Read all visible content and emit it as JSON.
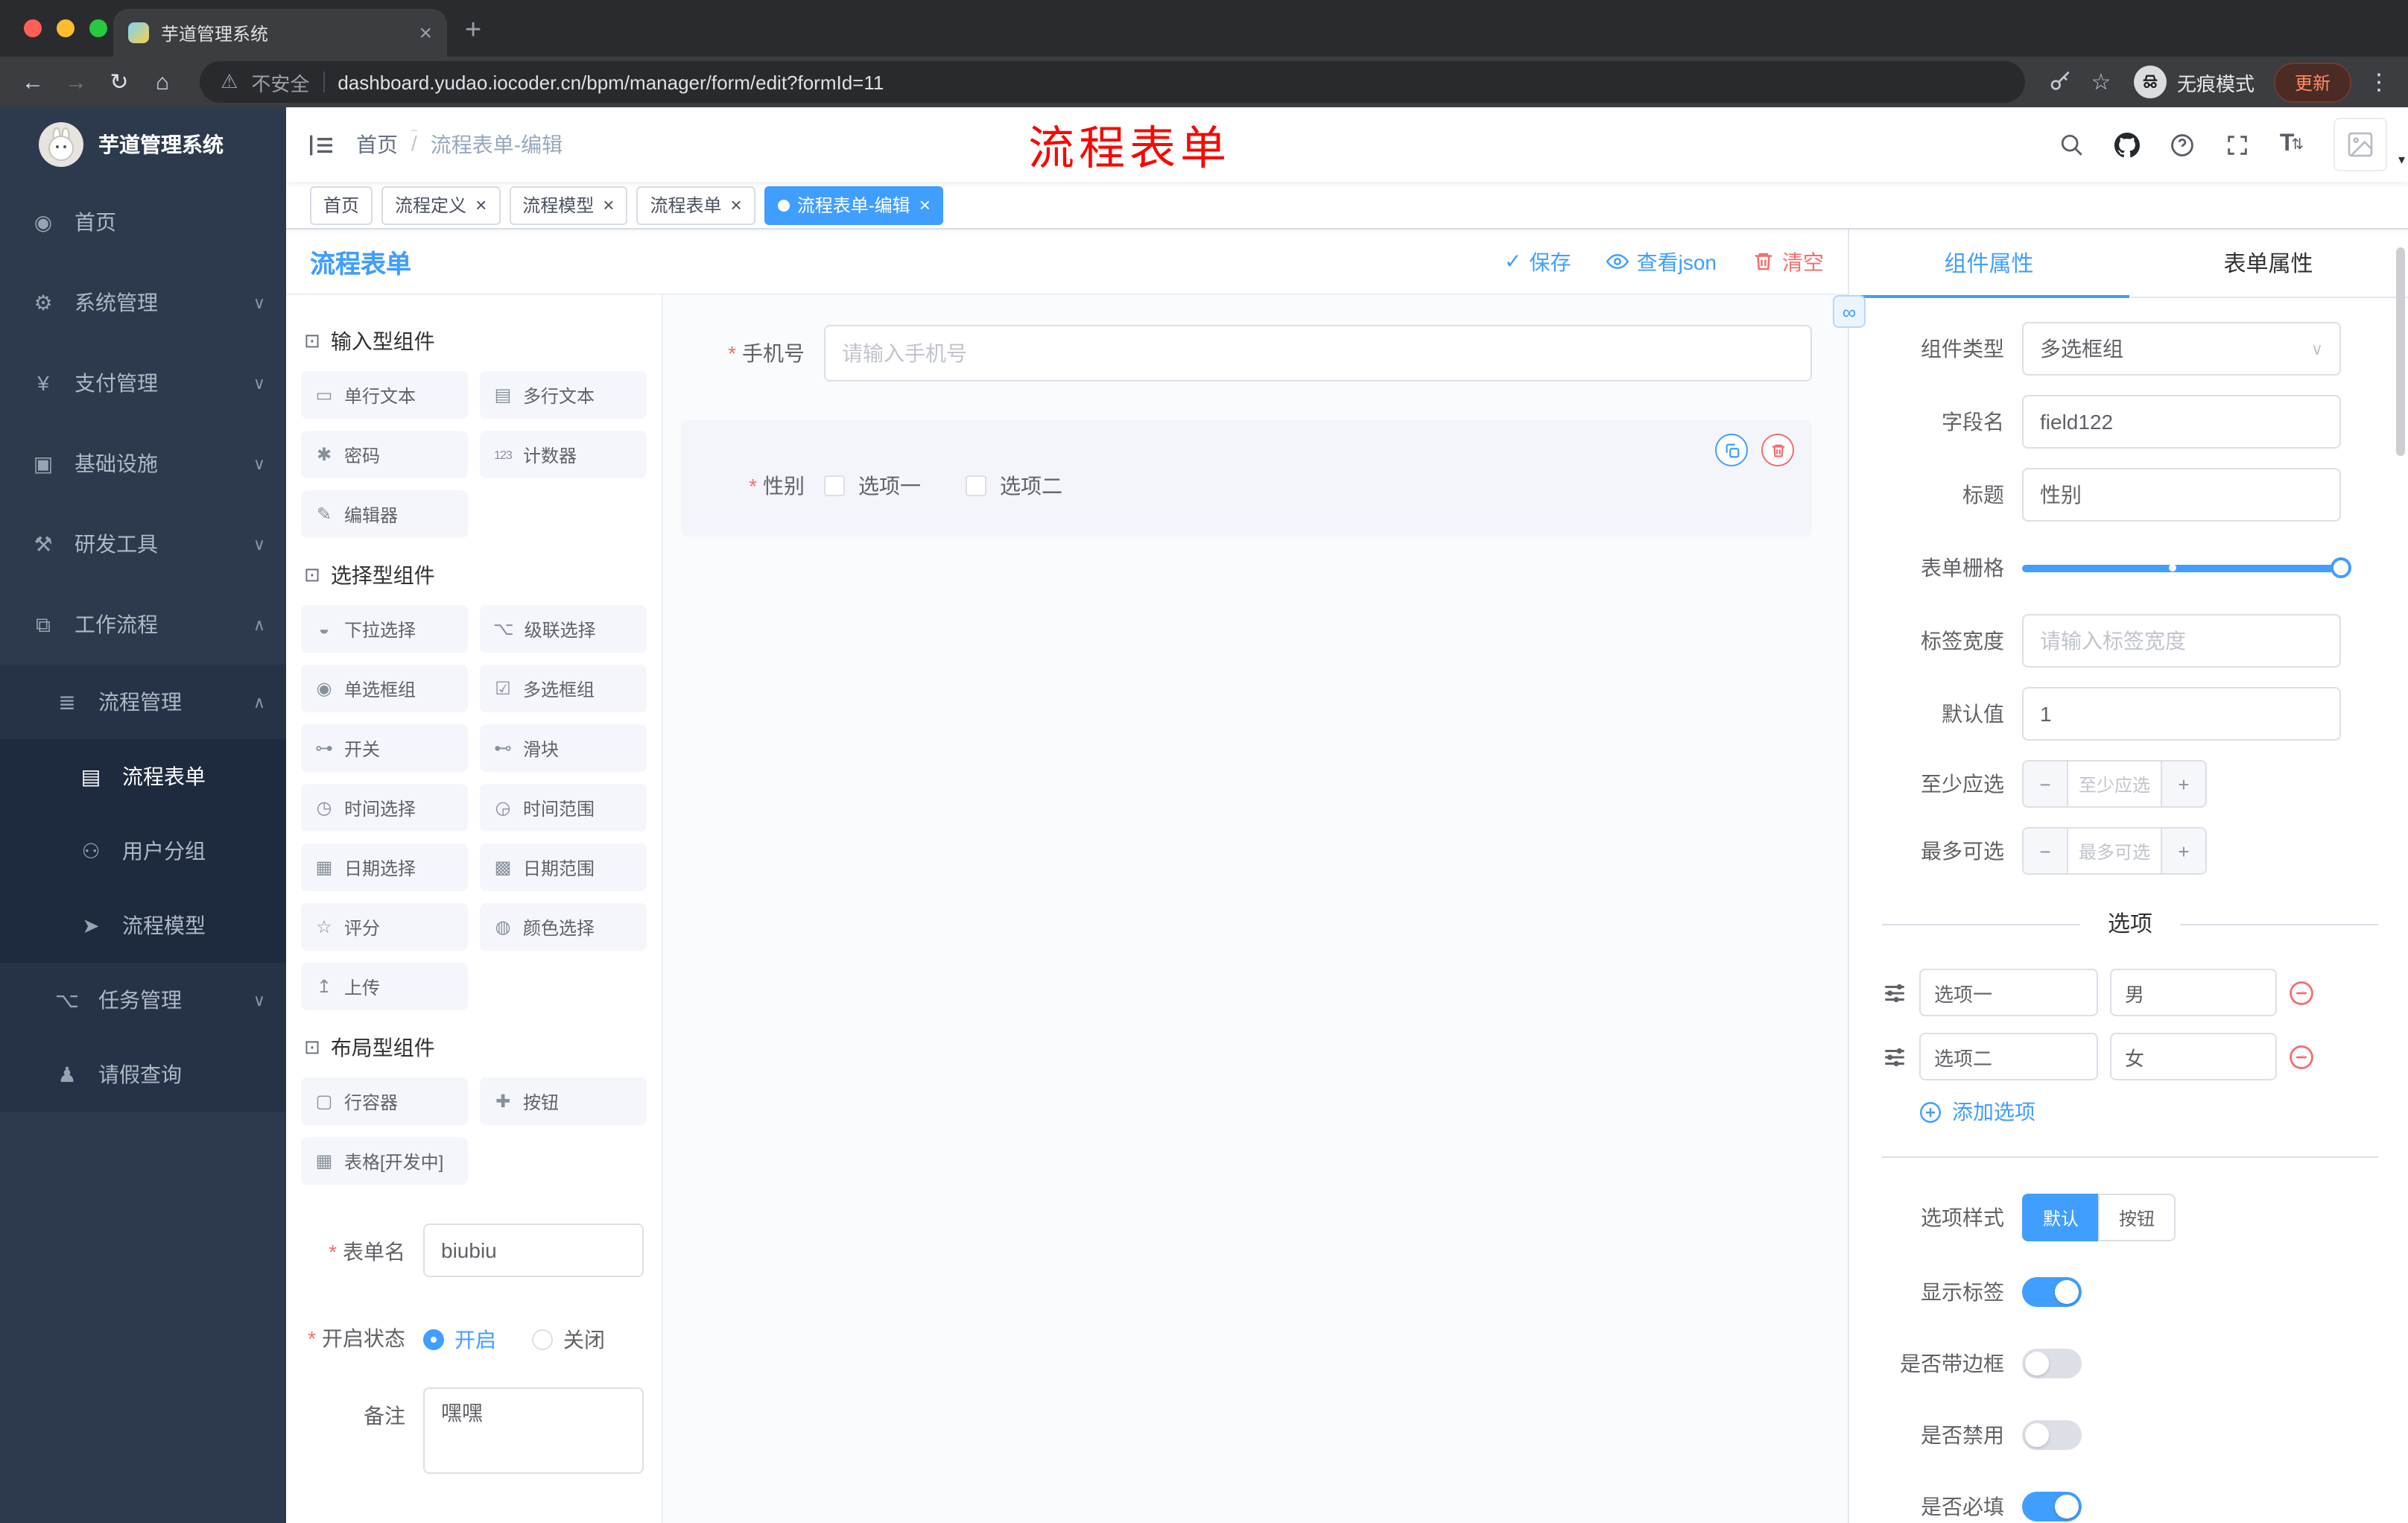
{
  "chrome": {
    "tab_title": "芋道管理系统",
    "security": "不安全",
    "url": "dashboard.yudao.iocoder.cn/bpm/manager/form/edit?formId=11",
    "incognito": "无痕模式",
    "update": "更新"
  },
  "icons": {
    "back": "←",
    "forward": "→",
    "reload": "↻",
    "home": "⌂",
    "warning": "⚠",
    "star": "☆",
    "more": "⋮",
    "close": "×",
    "new_tab": "+",
    "check": "✓",
    "link": "∞",
    "select_arrow": "∨",
    "minus": "−",
    "plus": "+",
    "caret": "▾",
    "font_size": "T",
    "updown": "⇅",
    "group": "⊡",
    "sidebar": {
      "dashboard": "◉",
      "gear": "⚙",
      "yen": "¥",
      "monitor": "▣",
      "tools": "⚒",
      "workflow": "⧉",
      "process": "≣",
      "form": "▤",
      "users": "⚇",
      "send": "➤",
      "tasks": "⌥",
      "person": "♟"
    },
    "components": {
      "single-line": "▭",
      "multi-line": "▤",
      "password": "✱",
      "counter": "123",
      "editor": "✎",
      "select": "◒",
      "cascader": "⌥",
      "radio": "◉",
      "checkbox": "☑",
      "switch": "⊶",
      "slider": "⊷",
      "time": "◷",
      "time-range": "◶",
      "date": "▦",
      "date-range": "▩",
      "rate": "☆",
      "color": "◍",
      "upload": "↥",
      "row": "▢",
      "button": "✚",
      "table": "▦"
    }
  },
  "sidebar": {
    "app_title": "芋道管理系统",
    "menu": [
      {
        "label": "首页",
        "icon": "dashboard"
      },
      {
        "label": "系统管理",
        "icon": "gear",
        "chevron": "down"
      },
      {
        "label": "支付管理",
        "icon": "yen",
        "chevron": "down"
      },
      {
        "label": "基础设施",
        "icon": "monitor",
        "chevron": "down"
      },
      {
        "label": "研发工具",
        "icon": "tools",
        "chevron": "down"
      },
      {
        "label": "工作流程",
        "icon": "workflow",
        "chevron": "up"
      },
      {
        "label": "流程管理",
        "icon": "process",
        "chevron": "up",
        "level": 1
      },
      {
        "label": "流程表单",
        "icon": "form",
        "level": 2,
        "active": true
      },
      {
        "label": "用户分组",
        "icon": "users",
        "level": 2
      },
      {
        "label": "流程模型",
        "icon": "send",
        "level": 2
      },
      {
        "label": "任务管理",
        "icon": "tasks",
        "chevron": "down",
        "level": 1
      },
      {
        "label": "请假查询",
        "icon": "person",
        "level": 1
      }
    ]
  },
  "header": {
    "breadcrumb_home": "首页",
    "breadcrumb_current": "流程表单-编辑",
    "annotation": "流程表单"
  },
  "tags": [
    {
      "label": "首页"
    },
    {
      "label": "流程定义",
      "closable": true
    },
    {
      "label": "流程模型",
      "closable": true
    },
    {
      "label": "流程表单",
      "closable": true
    },
    {
      "label": "流程表单-编辑",
      "closable": true,
      "active": true
    }
  ],
  "designer": {
    "title": "流程表单",
    "save": "保存",
    "view_json": "查看json",
    "clear": "清空",
    "groups": [
      {
        "title": "输入型组件",
        "items": [
          {
            "label": "单行文本",
            "icon": "single-line"
          },
          {
            "label": "多行文本",
            "icon": "multi-line"
          },
          {
            "label": "密码",
            "icon": "password"
          },
          {
            "label": "计数器",
            "icon": "counter"
          },
          {
            "label": "编辑器",
            "icon": "editor"
          }
        ]
      },
      {
        "title": "选择型组件",
        "items": [
          {
            "label": "下拉选择",
            "icon": "select"
          },
          {
            "label": "级联选择",
            "icon": "cascader"
          },
          {
            "label": "单选框组",
            "icon": "radio"
          },
          {
            "label": "多选框组",
            "icon": "checkbox"
          },
          {
            "label": "开关",
            "icon": "switch"
          },
          {
            "label": "滑块",
            "icon": "slider"
          },
          {
            "label": "时间选择",
            "icon": "time"
          },
          {
            "label": "时间范围",
            "icon": "time-range"
          },
          {
            "label": "日期选择",
            "icon": "date"
          },
          {
            "label": "日期范围",
            "icon": "date-range"
          },
          {
            "label": "评分",
            "icon": "rate"
          },
          {
            "label": "颜色选择",
            "icon": "color"
          },
          {
            "label": "上传",
            "icon": "upload"
          }
        ]
      },
      {
        "title": "布局型组件",
        "items": [
          {
            "label": "行容器",
            "icon": "row"
          },
          {
            "label": "按钮",
            "icon": "button"
          },
          {
            "label": "表格[开发中]",
            "icon": "table"
          }
        ]
      }
    ],
    "meta_form": {
      "name_label": "表单名",
      "name_value": "biubiu",
      "status_label": "开启状态",
      "status_on": "开启",
      "status_off": "关闭",
      "remark_label": "备注",
      "remark_value": "嘿嘿"
    }
  },
  "canvas": {
    "phone_label": "手机号",
    "phone_placeholder": "请输入手机号",
    "gender_label": "性别",
    "gender_options": [
      "选项一",
      "选项二"
    ]
  },
  "props": {
    "tab_component": "组件属性",
    "tab_form": "表单属性",
    "rows": {
      "type_label": "组件类型",
      "type_value": "多选框组",
      "field_label": "字段名",
      "field_value": "field122",
      "title_label": "标题",
      "title_value": "性别",
      "grid_label": "表单栅格",
      "labelw_label": "标签宽度",
      "labelw_placeholder": "请输入标签宽度",
      "default_label": "默认值",
      "default_value": "1",
      "min_label": "至少应选",
      "min_placeholder": "至少应选",
      "max_label": "最多可选",
      "max_placeholder": "最多可选"
    },
    "options_title": "选项",
    "options": [
      {
        "name": "选项一",
        "value": "男"
      },
      {
        "name": "选项二",
        "value": "女"
      }
    ],
    "add_option": "添加选项",
    "style_label": "选项样式",
    "style_default": "默认",
    "style_button": "按钮",
    "switches": [
      {
        "label": "显示标签",
        "on": true
      },
      {
        "label": "是否带边框",
        "on": false
      },
      {
        "label": "是否禁用",
        "on": false
      },
      {
        "label": "是否必填",
        "on": true
      }
    ],
    "colors": {
      "primary": "#409eff",
      "danger": "#f56c6c"
    }
  }
}
